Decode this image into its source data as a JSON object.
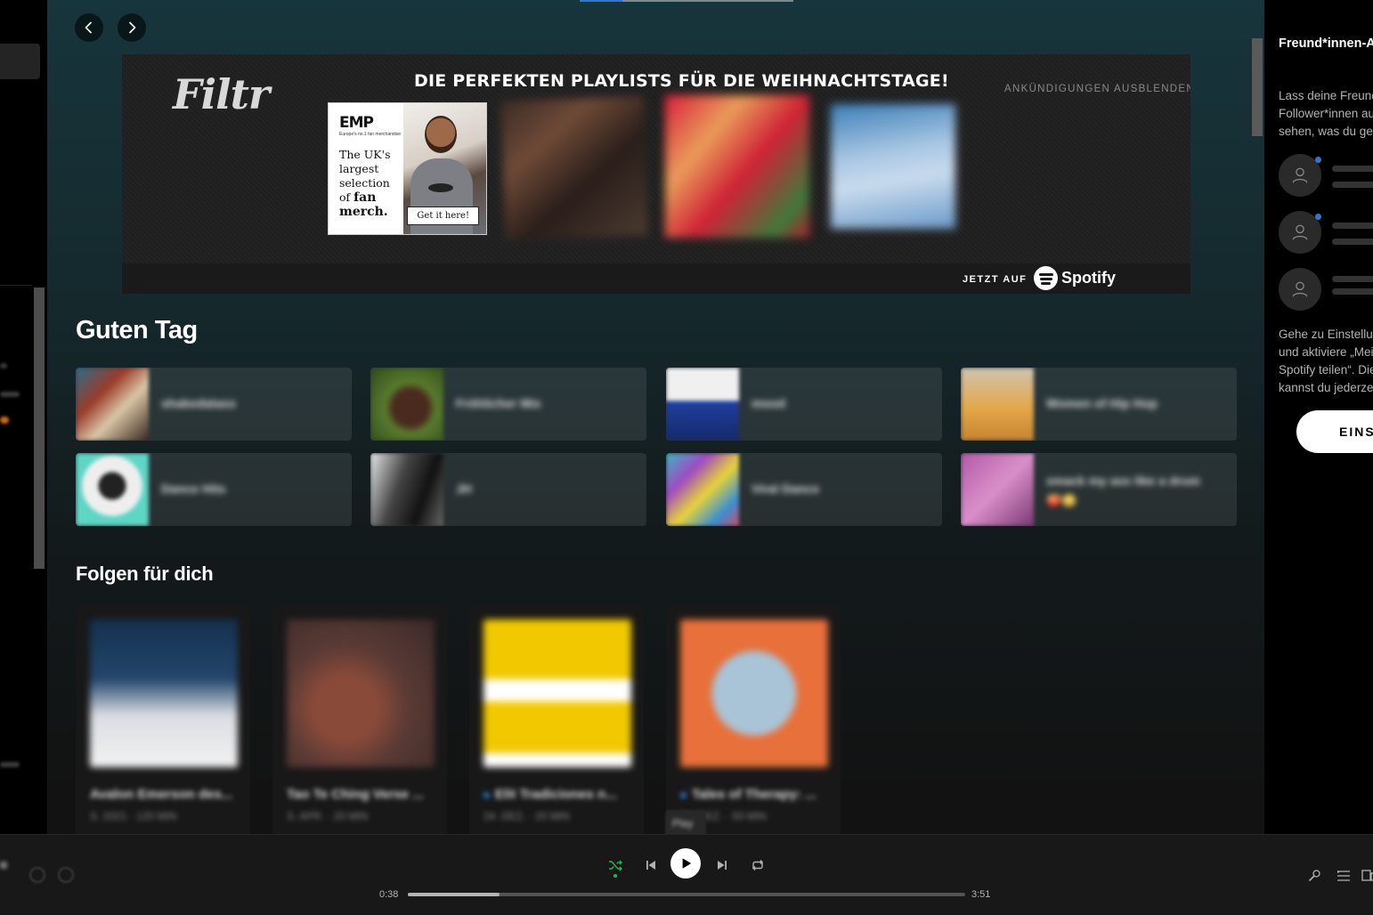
{
  "banner": {
    "logo": "Filtr",
    "title": "DIE PERFEKTEN PLAYLISTS FÜR DIE WEIHNACHTSTAGE!",
    "hide_ads": "ANKÜNDIGUNGEN AUSBLENDEN",
    "ad": {
      "logo": "EMP",
      "tagline": "Europe's no.1 fan merchandise",
      "line1": "The UK's",
      "line2": "largest",
      "line3": "selection",
      "line4_a": "of ",
      "line4_b": "fan",
      "line5": "merch.",
      "button": "Get it here!"
    },
    "jetzt_auf": "JETZT AUF",
    "spotify": "Spotify"
  },
  "sections": {
    "greeting": "Guten Tag",
    "follow": "Folgen für dich"
  },
  "shortcuts": [
    {
      "name": "shakedatass"
    },
    {
      "name": "Fröhlicher Mix"
    },
    {
      "name": "mood"
    },
    {
      "name": "Women of Hip Hop"
    },
    {
      "name": "Dance Hits"
    },
    {
      "name": "JH"
    },
    {
      "name": "Viral Dance"
    },
    {
      "name": "smack my ass like a drum 🍑😳"
    }
  ],
  "cards": [
    {
      "title": "Avalon Emerson des...",
      "meta": "S. 2021 · 120 MIN"
    },
    {
      "title": "Tao Te Ching Verse ...",
      "meta": "S. APR. · 20 MIN"
    },
    {
      "title": "Elit Tradiciones n...",
      "meta": "24. DEZ. · 20 MIN"
    },
    {
      "title": "Tales of Therapy: ...",
      "meta": "21. DEZ. · 50 MIN"
    }
  ],
  "tooltip": "Play",
  "friends": {
    "title": "Freund*innen-Aktivität",
    "desc": "Lass deine Freund*innen und Follower*innen auf Spotify sehen, was du gerade hörst",
    "help": "Gehe zu Einstellungen > Soziales und aktiviere „Meine Hörtätigkeit auf Spotify teilen“. Diese Einstellung kannst du jederzeit deaktivieren.",
    "button": "EINSTELLUNGEN"
  },
  "player": {
    "elapsed": "0:38",
    "duration": "3:51",
    "progress_fraction": 0.164
  },
  "colors": {
    "accent_green": "#1db954",
    "badge_blue": "#2e77d0"
  }
}
